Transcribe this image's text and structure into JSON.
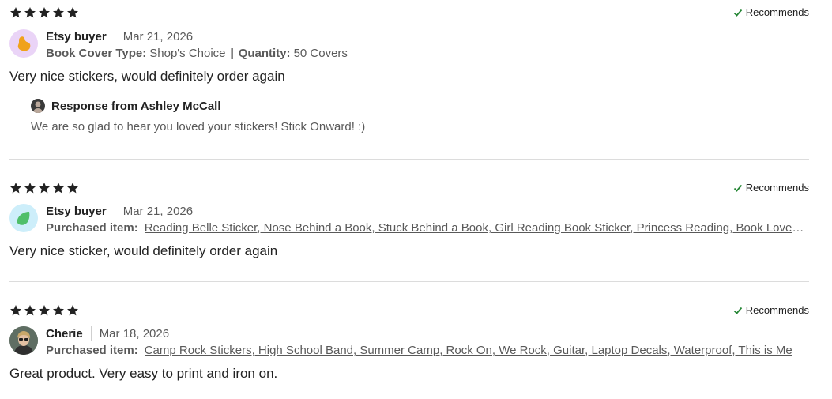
{
  "colors": {
    "star": "#222222",
    "check": "#258635",
    "avatar1_bg": "#ead4f7",
    "avatar1_fg": "#f0a21b",
    "avatar2_bg": "#cdeefa",
    "avatar2_fg": "#4fbf6a"
  },
  "reviews": [
    {
      "rating": 5,
      "recommends": "Recommends",
      "reviewer": "Etsy buyer",
      "date": "Mar 21, 2026",
      "detail1_label": "Book Cover Type:",
      "detail1_value": "Shop's Choice",
      "detail_sep": "|",
      "detail2_label": "Quantity:",
      "detail2_value": "50 Covers",
      "text": "Very nice stickers, would definitely order again",
      "response": {
        "title": "Response from Ashley McCall",
        "text": "We are so glad to hear you loved your stickers! Stick Onward! :)"
      }
    },
    {
      "rating": 5,
      "recommends": "Recommends",
      "reviewer": "Etsy buyer",
      "date": "Mar 21, 2026",
      "item_label": "Purchased item:",
      "item_link": "Reading Belle Sticker, Nose Behind a Book, Stuck Behind a Book, Girl Reading Book Sticker, Princess Reading, Book Lover Sticker",
      "text": "Very nice sticker, would definitely order again"
    },
    {
      "rating": 5,
      "recommends": "Recommends",
      "reviewer": "Cherie",
      "date": "Mar 18, 2026",
      "item_label": "Purchased item:",
      "item_link": "Camp Rock Stickers, High School Band, Summer Camp, Rock On, We Rock, Guitar, Laptop Decals, Waterproof, This is Me",
      "text": "Great product. Very easy to print and iron on."
    }
  ]
}
